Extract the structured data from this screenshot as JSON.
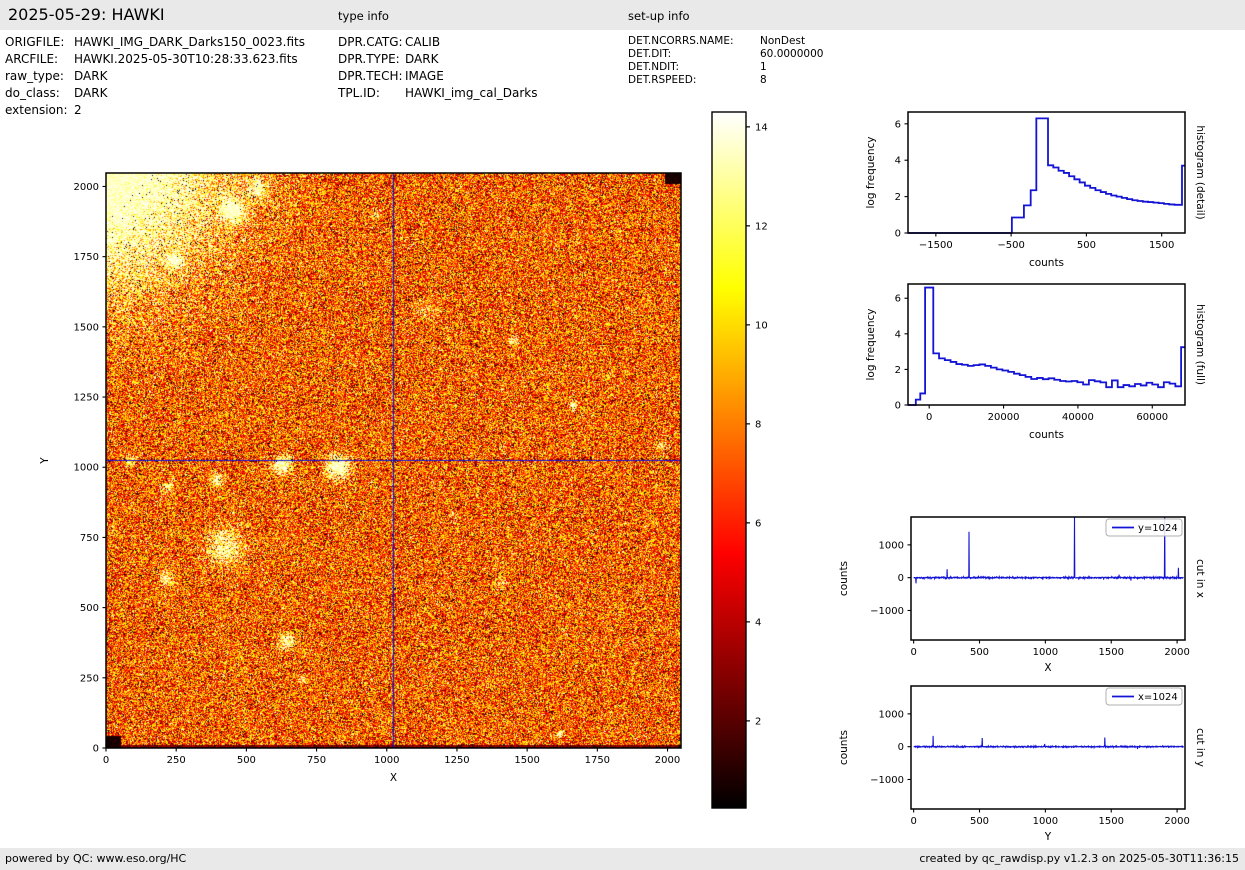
{
  "header": {
    "title": "2025-05-29: HAWKI",
    "type_info_label": "type info",
    "setup_info_label": "set-up info"
  },
  "file_info": {
    "rows": [
      {
        "label": "ORIGFILE:",
        "value": "HAWKI_IMG_DARK_Darks150_0023.fits"
      },
      {
        "label": "ARCFILE:",
        "value": "HAWKI.2025-05-30T10:28:33.623.fits"
      },
      {
        "label": "raw_type:",
        "value": "DARK"
      },
      {
        "label": "do_class:",
        "value": "DARK"
      },
      {
        "label": "extension:",
        "value": "2"
      }
    ]
  },
  "type_info": {
    "rows": [
      {
        "label": "DPR.CATG:",
        "value": "CALIB"
      },
      {
        "label": "DPR.TYPE:",
        "value": "DARK"
      },
      {
        "label": "DPR.TECH:",
        "value": "IMAGE"
      },
      {
        "label": "TPL.ID:",
        "value": "HAWKI_img_cal_Darks"
      }
    ]
  },
  "setup_info": {
    "rows": [
      {
        "label": "DET.NCORRS.NAME:",
        "value": "NonDest"
      },
      {
        "label": "DET.DIT:",
        "value": "60.0000000"
      },
      {
        "label": "DET.NDIT:",
        "value": "1"
      },
      {
        "label": "DET.RSPEED:",
        "value": "8"
      }
    ]
  },
  "footer": {
    "left": "powered by QC: www.eso.org/HC",
    "right": "created by qc_rawdisp.py v1.2.3 on 2025-05-30T11:36:15"
  },
  "colors": {
    "line_blue": "#1414d4",
    "bar_bg": "#e9e9e9",
    "hot_stops": [
      "#000000",
      "#ff0000",
      "#ffff00",
      "#ffffff"
    ],
    "legend_border": "#b0b0b0"
  },
  "chart_data": [
    {
      "id": "main_image",
      "name": "dark-frame-heatmap",
      "type": "heatmap",
      "xlabel": "X",
      "ylabel": "Y",
      "xlim": [
        0,
        2048
      ],
      "ylim": [
        0,
        2048
      ],
      "xticks": {
        "values": [
          0,
          250,
          500,
          750,
          1000,
          1250,
          1500,
          1750,
          2000
        ],
        "labels": [
          "0",
          "250",
          "500",
          "750",
          "1000",
          "1250",
          "1500",
          "1750",
          "2000"
        ]
      },
      "yticks": {
        "values": [
          0,
          250,
          500,
          750,
          1000,
          1250,
          1500,
          1750,
          2000
        ],
        "labels": [
          "0",
          "250",
          "500",
          "750",
          "1000",
          "1250",
          "1500",
          "1750",
          "2000"
        ]
      },
      "colormap": "hot",
      "crosshair": {
        "x": 1024,
        "y": 1024
      },
      "noise": {
        "seed": 1337,
        "black_fraction": 0.055,
        "white_fraction": 0.04,
        "base_lo": 0.2,
        "base_span": 0.6,
        "dark_row_period": 205
      },
      "glow_corner": {
        "x": -40,
        "y": 2110,
        "sigma": 400,
        "amp": 1.15
      },
      "blobs": [
        [
          450,
          1915,
          40,
          0.95
        ],
        [
          246,
          1734,
          26,
          0.7
        ],
        [
          540,
          1990,
          34,
          0.6
        ],
        [
          960,
          1900,
          18,
          0.35
        ],
        [
          627,
          1008,
          30,
          0.85
        ],
        [
          826,
          1001,
          38,
          0.95
        ],
        [
          395,
          955,
          22,
          0.6
        ],
        [
          221,
          930,
          20,
          0.5
        ],
        [
          424,
          713,
          62,
          0.55
        ],
        [
          217,
          606,
          24,
          0.5
        ],
        [
          644,
          378,
          26,
          0.6
        ],
        [
          701,
          243,
          14,
          0.5
        ],
        [
          1456,
          1446,
          16,
          0.5
        ],
        [
          1663,
          1222,
          14,
          0.6
        ],
        [
          1143,
          1560,
          30,
          0.3
        ],
        [
          1410,
          592,
          20,
          0.3
        ],
        [
          1980,
          1080,
          16,
          0.4
        ],
        [
          1616,
          50,
          9,
          1.0
        ],
        [
          90,
          1024,
          18,
          0.5
        ],
        [
          1240,
          820,
          16,
          0.3
        ]
      ],
      "dark_corners": [
        [
          0,
          0,
          55,
          42
        ],
        [
          1992,
          2008,
          2048,
          2048
        ],
        [
          2036,
          0,
          2048,
          10
        ]
      ]
    },
    {
      "id": "hist_detail",
      "name": "histogram-detail",
      "type": "step",
      "xlabel": "counts",
      "ylabel": "log frequency",
      "side_label": "histogram (detail)",
      "xlim": [
        -1870,
        1810
      ],
      "ylim": [
        0,
        6.65
      ],
      "xticks": {
        "values": [
          -1500,
          -500,
          500,
          1500
        ],
        "labels": [
          "−1500",
          "−500",
          "500",
          "1500"
        ]
      },
      "yticks": {
        "values": [
          0,
          2,
          4,
          6
        ],
        "labels": [
          "0",
          "2",
          "4",
          "6"
        ]
      },
      "steps": [
        [
          -1870,
          0
        ],
        [
          -490,
          0.85
        ],
        [
          -330,
          1.52
        ],
        [
          -240,
          2.35
        ],
        [
          -165,
          6.3
        ],
        [
          -10,
          3.72
        ],
        [
          60,
          3.6
        ],
        [
          130,
          3.42
        ],
        [
          200,
          3.3
        ],
        [
          270,
          3.12
        ],
        [
          340,
          2.95
        ],
        [
          410,
          2.78
        ],
        [
          480,
          2.6
        ],
        [
          550,
          2.48
        ],
        [
          620,
          2.35
        ],
        [
          690,
          2.25
        ],
        [
          760,
          2.15
        ],
        [
          830,
          2.06
        ],
        [
          900,
          2.0
        ],
        [
          970,
          1.93
        ],
        [
          1040,
          1.86
        ],
        [
          1110,
          1.8
        ],
        [
          1180,
          1.76
        ],
        [
          1250,
          1.72
        ],
        [
          1320,
          1.7
        ],
        [
          1390,
          1.67
        ],
        [
          1460,
          1.64
        ],
        [
          1530,
          1.6
        ],
        [
          1600,
          1.57
        ],
        [
          1670,
          1.55
        ],
        [
          1770,
          3.7
        ]
      ],
      "xmax": 1810
    },
    {
      "id": "hist_full",
      "name": "histogram-full",
      "type": "step",
      "xlabel": "counts",
      "ylabel": "log frequency",
      "side_label": "histogram (full)",
      "xlim": [
        -5700,
        68800
      ],
      "ylim": [
        0,
        6.8
      ],
      "xticks": {
        "values": [
          0,
          20000,
          40000,
          60000
        ],
        "labels": [
          "0",
          "20000",
          "40000",
          "60000"
        ]
      },
      "yticks": {
        "values": [
          0,
          2,
          4,
          6
        ],
        "labels": [
          "0",
          "2",
          "4",
          "6"
        ]
      },
      "steps": [
        [
          -5700,
          0
        ],
        [
          -3600,
          0.3
        ],
        [
          -2400,
          0.65
        ],
        [
          -1100,
          6.6
        ],
        [
          1100,
          2.9
        ],
        [
          2650,
          2.62
        ],
        [
          4200,
          2.52
        ],
        [
          5750,
          2.42
        ],
        [
          7300,
          2.3
        ],
        [
          8850,
          2.26
        ],
        [
          10400,
          2.2
        ],
        [
          11950,
          2.24
        ],
        [
          13500,
          2.28
        ],
        [
          15050,
          2.2
        ],
        [
          16600,
          2.1
        ],
        [
          18150,
          2.0
        ],
        [
          19700,
          1.94
        ],
        [
          21250,
          1.86
        ],
        [
          22800,
          1.76
        ],
        [
          24350,
          1.68
        ],
        [
          25900,
          1.58
        ],
        [
          27450,
          1.46
        ],
        [
          29000,
          1.52
        ],
        [
          30550,
          1.45
        ],
        [
          32100,
          1.5
        ],
        [
          33650,
          1.42
        ],
        [
          35200,
          1.35
        ],
        [
          36750,
          1.32
        ],
        [
          38300,
          1.35
        ],
        [
          39850,
          1.28
        ],
        [
          41400,
          1.15
        ],
        [
          42950,
          1.4
        ],
        [
          44500,
          1.33
        ],
        [
          46050,
          1.27
        ],
        [
          47600,
          1.0
        ],
        [
          49150,
          1.38
        ],
        [
          50700,
          1.0
        ],
        [
          52250,
          1.12
        ],
        [
          53800,
          1.05
        ],
        [
          55350,
          1.18
        ],
        [
          56900,
          1.1
        ],
        [
          58450,
          1.25
        ],
        [
          60000,
          1.15
        ],
        [
          61550,
          1.0
        ],
        [
          63100,
          1.28
        ],
        [
          64650,
          1.2
        ],
        [
          66200,
          1.05
        ],
        [
          67750,
          3.25
        ]
      ],
      "xmax": 68800
    },
    {
      "id": "cut_x",
      "name": "cut-in-x",
      "type": "line",
      "xlabel": "X",
      "ylabel": "counts",
      "side_label": "cut in x",
      "legend": "y=1024",
      "xlim": [
        -20,
        2060
      ],
      "ylim": [
        -1900,
        1850
      ],
      "xticks": {
        "values": [
          0,
          500,
          1000,
          1500,
          2000
        ],
        "labels": [
          "0",
          "500",
          "1000",
          "1500",
          "2000"
        ]
      },
      "yticks": {
        "values": [
          -1000,
          0,
          1000
        ],
        "labels": [
          "−1000",
          "0",
          "1000"
        ]
      },
      "noise": {
        "seed": 77,
        "amp": 18,
        "n": 1024
      },
      "spikes": [
        {
          "x": 18,
          "v": -170
        },
        {
          "x": 255,
          "v": 255
        },
        {
          "x": 420,
          "v": 1400
        },
        {
          "x": 1222,
          "v": 2600
        },
        {
          "x": 1560,
          "v": 90
        },
        {
          "x": 1650,
          "v": -90
        },
        {
          "x": 1905,
          "v": 2600
        },
        {
          "x": 2010,
          "v": 300
        }
      ]
    },
    {
      "id": "cut_y",
      "name": "cut-in-y",
      "type": "line",
      "xlabel": "Y",
      "ylabel": "counts",
      "side_label": "cut in y",
      "legend": "x=1024",
      "xlim": [
        -20,
        2060
      ],
      "ylim": [
        -1900,
        1850
      ],
      "xticks": {
        "values": [
          0,
          500,
          1000,
          1500,
          2000
        ],
        "labels": [
          "0",
          "500",
          "1000",
          "1500",
          "2000"
        ]
      },
      "yticks": {
        "values": [
          -1000,
          0,
          1000
        ],
        "labels": [
          "−1000",
          "0",
          "1000"
        ]
      },
      "noise": {
        "seed": 911,
        "amp": 15,
        "n": 1024
      },
      "spikes": [
        {
          "x": 148,
          "v": 330
        },
        {
          "x": 520,
          "v": 265
        },
        {
          "x": 995,
          "v": 85
        },
        {
          "x": 1452,
          "v": 280
        },
        {
          "x": 1700,
          "v": -70
        }
      ]
    },
    {
      "id": "colorbar",
      "name": "colorbar",
      "type": "colorbar",
      "colormap": "hot",
      "vmin": 0.24,
      "vmax": 14.3,
      "ticks": {
        "values": [
          2,
          4,
          6,
          8,
          10,
          12,
          14
        ],
        "labels": [
          "2",
          "4",
          "6",
          "8",
          "10",
          "12",
          "14"
        ]
      }
    }
  ]
}
